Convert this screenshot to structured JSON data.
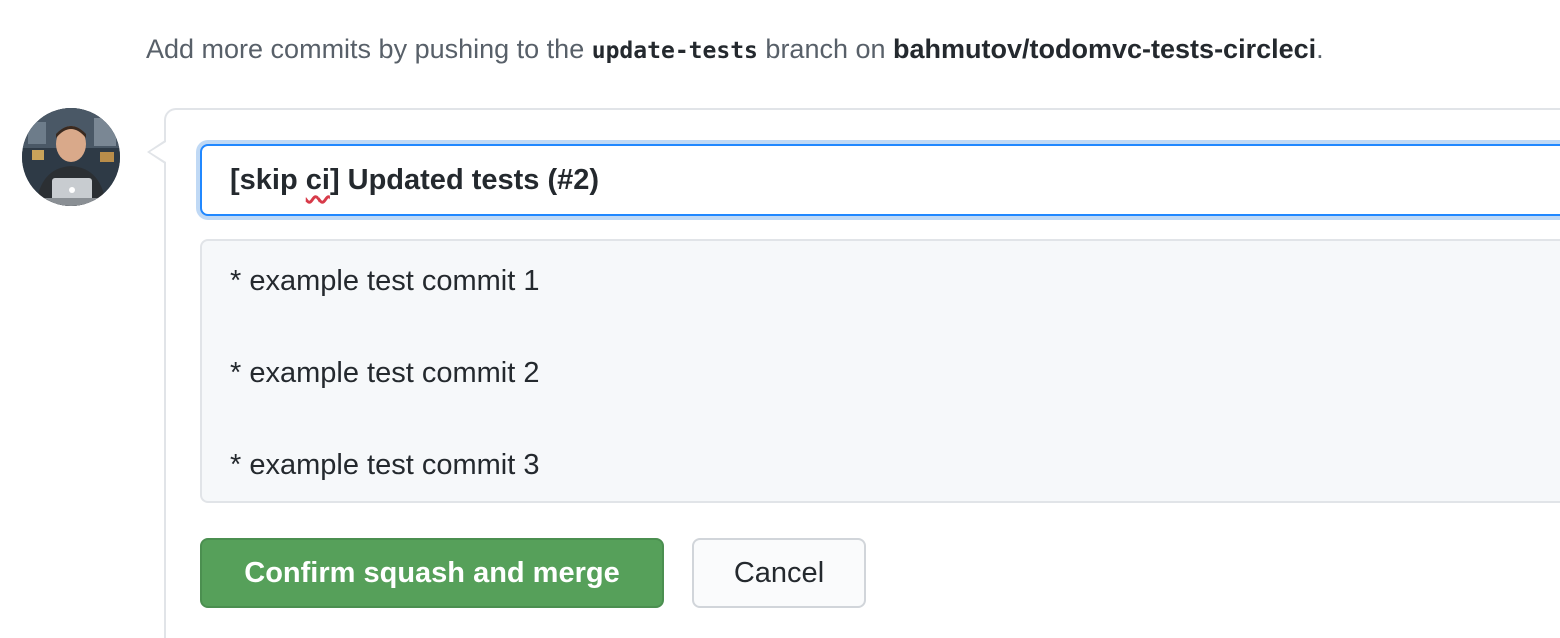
{
  "hint": {
    "prefix": "Add more commits by pushing to the",
    "branch": "update-tests",
    "middle": "branch on",
    "repo": "bahmutov/todomvc-tests-circleci",
    "suffix": "."
  },
  "merge": {
    "title_prefix": "[skip ",
    "title_misspelled": "ci",
    "title_suffix": "] Updated tests (#2)",
    "body_lines": [
      "* example test commit 1",
      "* example test commit 2",
      "* example test commit 3"
    ],
    "confirm_label": "Confirm squash and merge",
    "cancel_label": "Cancel"
  },
  "colors": {
    "confirm_button": "#56a05a",
    "focus_ring": "#2188ff",
    "body_background": "#f6f8fa"
  },
  "avatar": {
    "icon": "user-avatar"
  }
}
